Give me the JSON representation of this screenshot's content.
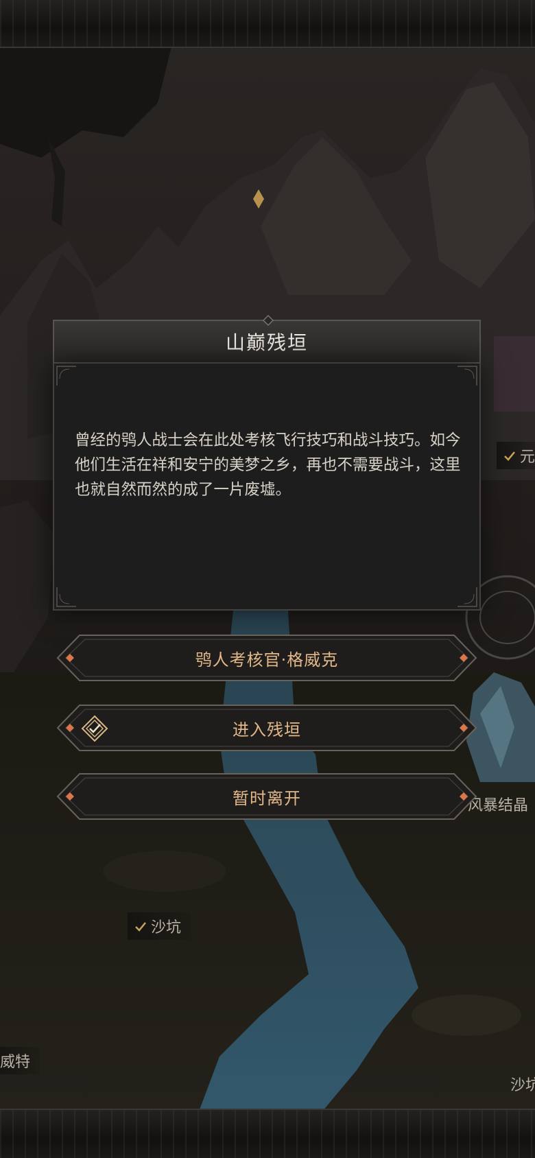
{
  "map": {
    "labels": [
      {
        "text": "元",
        "checked": true
      },
      {
        "text": "风暴结晶",
        "checked": false
      },
      {
        "text": "沙坑",
        "checked": true
      },
      {
        "text": "威特",
        "checked": false
      },
      {
        "text": "沙坑",
        "checked": false
      }
    ]
  },
  "dialog": {
    "title": "山巅残垣",
    "description": "曾经的鸮人战士会在此处考核飞行技巧和战斗技巧。如今他们生活在祥和安宁的美梦之乡，再也不需要战斗，这里也就自然而然的成了一片废墟。"
  },
  "options": [
    {
      "label": "鸮人考核官·格威克",
      "icon": null
    },
    {
      "label": "进入残垣",
      "icon": "diamond-check-icon"
    },
    {
      "label": "暂时离开",
      "icon": null
    }
  ],
  "colors": {
    "option_text": "#e2b78a",
    "accent_gem": "#d9774a",
    "dialog_bg": "#1e1d1d"
  }
}
